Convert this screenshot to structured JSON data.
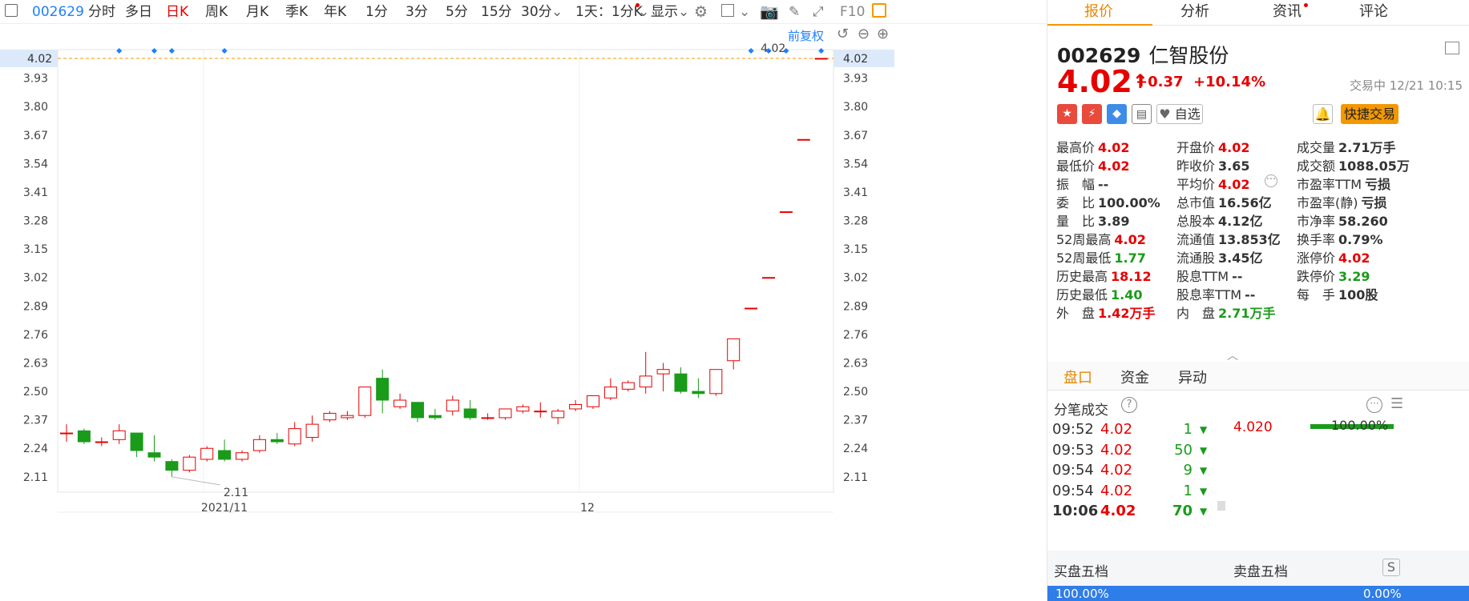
{
  "toolbar": {
    "code": "002629",
    "periods": [
      "分时",
      "多日",
      "日K",
      "周K",
      "月K",
      "季K",
      "年K",
      "1分",
      "3分",
      "5分",
      "15分",
      "30分"
    ],
    "active_period": "日K",
    "minute_select": "1天：1分K",
    "display_select": "显示",
    "f10": "F10"
  },
  "chart": {
    "adjust_label": "前复权",
    "price_label_left": "4.02",
    "price_label_right": "4.02",
    "max_label": "4.02",
    "min_label": "2.11",
    "y_ticks": [
      "3.93",
      "3.80",
      "3.67",
      "3.54",
      "3.41",
      "3.28",
      "3.15",
      "3.02",
      "2.89",
      "2.76",
      "2.63",
      "2.50",
      "2.37",
      "2.24",
      "2.11"
    ],
    "x_ticks": [
      "2021/11",
      "12"
    ],
    "colors": {
      "up": "#e60000",
      "down": "#1a9b1a",
      "line": "#f39800",
      "marker": "#1e80ff"
    }
  },
  "chart_data": {
    "type": "candlestick",
    "ylim": [
      2.04,
      4.06
    ],
    "y_ticks": [
      3.93,
      3.8,
      3.67,
      3.54,
      3.41,
      3.28,
      3.15,
      3.02,
      2.89,
      2.76,
      2.63,
      2.5,
      2.37,
      2.24,
      2.11
    ],
    "x_ticks": [
      "2021/11",
      "12"
    ],
    "candles": [
      {
        "o": 2.31,
        "c": 2.31,
        "h": 2.35,
        "l": 2.27
      },
      {
        "o": 2.32,
        "c": 2.27,
        "h": 2.33,
        "l": 2.26
      },
      {
        "o": 2.27,
        "c": 2.27,
        "h": 2.29,
        "l": 2.25
      },
      {
        "o": 2.28,
        "c": 2.32,
        "h": 2.35,
        "l": 2.26
      },
      {
        "o": 2.31,
        "c": 2.23,
        "h": 2.31,
        "l": 2.2
      },
      {
        "o": 2.22,
        "c": 2.2,
        "h": 2.3,
        "l": 2.18
      },
      {
        "o": 2.18,
        "c": 2.14,
        "h": 2.19,
        "l": 2.11
      },
      {
        "o": 2.14,
        "c": 2.2,
        "h": 2.21,
        "l": 2.13
      },
      {
        "o": 2.19,
        "c": 2.24,
        "h": 2.25,
        "l": 2.18
      },
      {
        "o": 2.23,
        "c": 2.19,
        "h": 2.28,
        "l": 2.18
      },
      {
        "o": 2.19,
        "c": 2.22,
        "h": 2.23,
        "l": 2.18
      },
      {
        "o": 2.23,
        "c": 2.28,
        "h": 2.3,
        "l": 2.22
      },
      {
        "o": 2.28,
        "c": 2.27,
        "h": 2.31,
        "l": 2.26
      },
      {
        "o": 2.26,
        "c": 2.33,
        "h": 2.36,
        "l": 2.25
      },
      {
        "o": 2.29,
        "c": 2.35,
        "h": 2.39,
        "l": 2.27
      },
      {
        "o": 2.37,
        "c": 2.4,
        "h": 2.41,
        "l": 2.36
      },
      {
        "o": 2.38,
        "c": 2.39,
        "h": 2.41,
        "l": 2.37
      },
      {
        "o": 2.39,
        "c": 2.52,
        "h": 2.52,
        "l": 2.38
      },
      {
        "o": 2.56,
        "c": 2.46,
        "h": 2.6,
        "l": 2.4
      },
      {
        "o": 2.43,
        "c": 2.46,
        "h": 2.49,
        "l": 2.42
      },
      {
        "o": 2.45,
        "c": 2.38,
        "h": 2.45,
        "l": 2.36
      },
      {
        "o": 2.39,
        "c": 2.38,
        "h": 2.42,
        "l": 2.37
      },
      {
        "o": 2.41,
        "c": 2.46,
        "h": 2.48,
        "l": 2.39
      },
      {
        "o": 2.42,
        "c": 2.38,
        "h": 2.46,
        "l": 2.37
      },
      {
        "o": 2.38,
        "c": 2.38,
        "h": 2.4,
        "l": 2.37
      },
      {
        "o": 2.38,
        "c": 2.42,
        "h": 2.42,
        "l": 2.37
      },
      {
        "o": 2.41,
        "c": 2.43,
        "h": 2.44,
        "l": 2.4
      },
      {
        "o": 2.41,
        "c": 2.41,
        "h": 2.45,
        "l": 2.38
      },
      {
        "o": 2.38,
        "c": 2.41,
        "h": 2.42,
        "l": 2.35
      },
      {
        "o": 2.42,
        "c": 2.44,
        "h": 2.46,
        "l": 2.41
      },
      {
        "o": 2.43,
        "c": 2.48,
        "h": 2.48,
        "l": 2.42
      },
      {
        "o": 2.47,
        "c": 2.52,
        "h": 2.56,
        "l": 2.46
      },
      {
        "o": 2.51,
        "c": 2.54,
        "h": 2.55,
        "l": 2.5
      },
      {
        "o": 2.52,
        "c": 2.57,
        "h": 2.68,
        "l": 2.49
      },
      {
        "o": 2.58,
        "c": 2.6,
        "h": 2.63,
        "l": 2.5
      },
      {
        "o": 2.58,
        "c": 2.5,
        "h": 2.61,
        "l": 2.49
      },
      {
        "o": 2.5,
        "c": 2.49,
        "h": 2.56,
        "l": 2.47
      },
      {
        "o": 2.49,
        "c": 2.6,
        "h": 2.6,
        "l": 2.48
      },
      {
        "o": 2.64,
        "c": 2.74,
        "h": 2.74,
        "l": 2.6
      },
      {
        "o": 2.88,
        "c": 2.88,
        "h": 2.88,
        "l": 2.88
      },
      {
        "o": 3.02,
        "c": 3.02,
        "h": 3.02,
        "l": 3.02
      },
      {
        "o": 3.32,
        "c": 3.32,
        "h": 3.32,
        "l": 3.32
      },
      {
        "o": 3.65,
        "c": 3.65,
        "h": 3.65,
        "l": 3.65
      },
      {
        "o": 4.02,
        "c": 4.02,
        "h": 4.02,
        "l": 4.02
      }
    ],
    "markers_at_candle": [
      3,
      5,
      6,
      9,
      39,
      40,
      41,
      43
    ],
    "last_price_line": 4.02
  },
  "quote": {
    "tabs": [
      "报价",
      "分析",
      "资讯",
      "评论"
    ],
    "code": "002629",
    "name": "仁智股份",
    "price": "4.02",
    "change": "+0.37",
    "change_pct": "+10.14%",
    "status": "交易中 12/21 10:15",
    "watch_label": "自选",
    "trade_label": "快捷交易",
    "stats": [
      [
        {
          "k": "最高价",
          "v": "4.02",
          "c": "r"
        },
        {
          "k": "开盘价",
          "v": "4.02",
          "c": "r"
        },
        {
          "k": "成交量",
          "v": "2.71万手",
          "c": "k"
        }
      ],
      [
        {
          "k": "最低价",
          "v": "4.02",
          "c": "r"
        },
        {
          "k": "昨收价",
          "v": "3.65",
          "c": "k"
        },
        {
          "k": "成交额",
          "v": "1088.05万",
          "c": "k"
        }
      ],
      [
        {
          "k": "振　幅",
          "v": "--",
          "c": "k"
        },
        {
          "k": "平均价",
          "v": "4.02",
          "c": "r"
        },
        {
          "k": "市盈率TTM",
          "v": "亏损",
          "c": "k"
        }
      ],
      [
        {
          "k": "委　比",
          "v": "100.00%",
          "c": "k"
        },
        {
          "k": "总市值",
          "v": "16.56亿",
          "c": "k"
        },
        {
          "k": "市盈率(静)",
          "v": "亏损",
          "c": "k"
        }
      ],
      [
        {
          "k": "量　比",
          "v": "3.89",
          "c": "k"
        },
        {
          "k": "总股本",
          "v": "4.12亿",
          "c": "k"
        },
        {
          "k": "市净率",
          "v": "58.260",
          "c": "k"
        }
      ],
      [
        {
          "k": "52周最高",
          "v": "4.02",
          "c": "r"
        },
        {
          "k": "流通值",
          "v": "13.853亿",
          "c": "k"
        },
        {
          "k": "换手率",
          "v": "0.79%",
          "c": "k"
        }
      ],
      [
        {
          "k": "52周最低",
          "v": "1.77",
          "c": "g"
        },
        {
          "k": "流通股",
          "v": "3.45亿",
          "c": "k"
        },
        {
          "k": "涨停价",
          "v": "4.02",
          "c": "r"
        }
      ],
      [
        {
          "k": "历史最高",
          "v": "18.12",
          "c": "r"
        },
        {
          "k": "股息TTM",
          "v": "--",
          "c": "k"
        },
        {
          "k": "跌停价",
          "v": "3.29",
          "c": "g"
        }
      ],
      [
        {
          "k": "历史最低",
          "v": "1.40",
          "c": "g"
        },
        {
          "k": "股息率TTM",
          "v": "--",
          "c": "k"
        },
        {
          "k": "每　手",
          "v": "100股",
          "c": "k"
        }
      ],
      [
        {
          "k": "外　盘",
          "v": "1.42万手",
          "c": "r"
        },
        {
          "k": "内　盘",
          "v": "2.71万手",
          "c": "g"
        },
        {
          "k": "",
          "v": "",
          "c": "k"
        }
      ]
    ],
    "subtabs": [
      "盘口",
      "资金",
      "异动"
    ],
    "ticks_title": "分笔成交",
    "ticks": [
      {
        "t": "09:52",
        "p": "4.02",
        "v": "1"
      },
      {
        "t": "09:53",
        "p": "4.02",
        "v": "50"
      },
      {
        "t": "09:54",
        "p": "4.02",
        "v": "9"
      },
      {
        "t": "09:54",
        "p": "4.02",
        "v": "1"
      },
      {
        "t": "10:06",
        "p": "4.02",
        "v": "70"
      }
    ],
    "level_price": "4.020",
    "level_pct": "100.00%",
    "buy5": "买盘五档",
    "sell5": "卖盘五档",
    "bottom_pct": "100.00%",
    "bottom_pct_right": "0.00%"
  }
}
